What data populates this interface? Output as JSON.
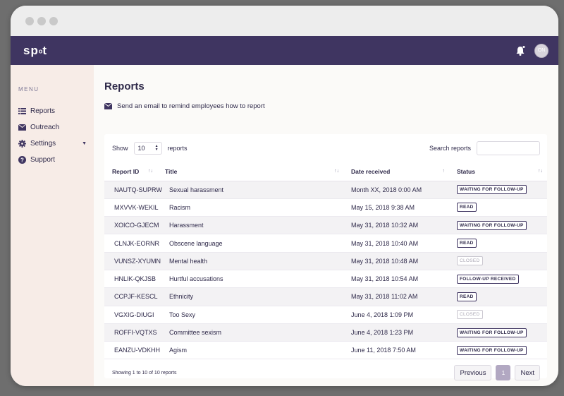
{
  "header": {
    "logo_left": "sp",
    "logo_mid": "o",
    "logo_right": "t",
    "avatar_initials": "ON"
  },
  "sidebar": {
    "menu_label": "MENU",
    "items": [
      {
        "label": "Reports",
        "icon": "list-icon"
      },
      {
        "label": "Outreach",
        "icon": "envelope-icon"
      },
      {
        "label": "Settings",
        "icon": "gear-icon"
      },
      {
        "label": "Support",
        "icon": "question-icon"
      }
    ]
  },
  "main": {
    "title": "Reports",
    "remind_text": "Send an email to remind employees how to report",
    "show_label": "Show",
    "page_size": "10",
    "reports_label": "reports",
    "search_label": "Search reports",
    "search_value": "",
    "columns": [
      "Report ID",
      "Title",
      "Date received",
      "Status"
    ],
    "rows": [
      {
        "id": "NAUTQ-SUPRW",
        "title": "Sexual harassment",
        "date": "Month XX, 2018 0:00 AM",
        "status": "WAITING FOR FOLLOW-UP"
      },
      {
        "id": "MXVVK-WEKIL",
        "title": "Racism",
        "date": "May 15, 2018 9:38 AM",
        "status": "READ"
      },
      {
        "id": "XOICO-GJECM",
        "title": "Harassment",
        "date": "May 31, 2018 10:32 AM",
        "status": "WAITING FOR FOLLOW-UP"
      },
      {
        "id": "CLNJK-EORNR",
        "title": "Obscene language",
        "date": "May 31, 2018 10:40 AM",
        "status": "READ"
      },
      {
        "id": "VUNSZ-XYUMN",
        "title": "Mental health",
        "date": "May 31, 2018 10:48 AM",
        "status": "CLOSED"
      },
      {
        "id": "HNLIK-QKJSB",
        "title": "Hurtful accusations",
        "date": "May 31, 2018 10:54 AM",
        "status": "FOLLOW-UP RECEIVED"
      },
      {
        "id": "CCPJF-KESCL",
        "title": "Ethnicity",
        "date": "May 31, 2018 11:02 AM",
        "status": "READ"
      },
      {
        "id": "VGXIG-DIUGI",
        "title": "Too Sexy",
        "date": "June 4, 2018 1:09 PM",
        "status": "CLOSED"
      },
      {
        "id": "ROFFI-VQTXS",
        "title": "Committee sexism",
        "date": "June 4, 2018 1:23 PM",
        "status": "WAITING FOR FOLLOW-UP"
      },
      {
        "id": "EANZU-VDKHH",
        "title": "Agism",
        "date": "June 11, 2018 7:50 AM",
        "status": "WAITING FOR FOLLOW-UP"
      }
    ],
    "showing_text": "Showing 1 to 10 of 10 reports",
    "pagination": {
      "previous": "Previous",
      "current": "1",
      "next": "Next"
    }
  },
  "colors": {
    "topbar": "#3f3561",
    "sidebar": "#f7ece7",
    "accent": "#b2a8c2"
  }
}
